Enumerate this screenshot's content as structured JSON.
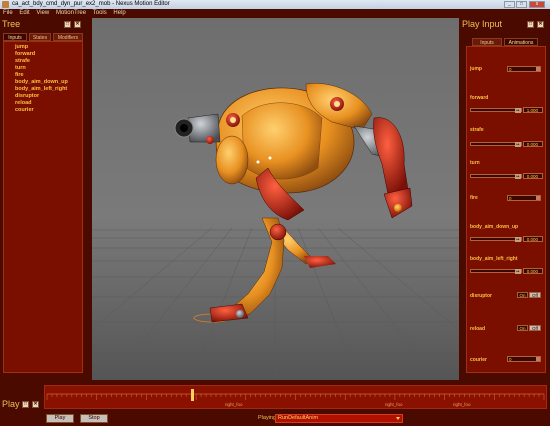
{
  "window": {
    "title": "ca_act_bdy_cmd_dyn_pur_ex2_mob - Nexus Motion Editor"
  },
  "menu": [
    "File",
    "Edit",
    "View",
    "MotionTree",
    "Tools",
    "Help"
  ],
  "tree": {
    "title": "Tree",
    "tabs": [
      "Inputs",
      "States",
      "Modifiers"
    ],
    "active_tab": "Inputs",
    "items": [
      "jump",
      "forward",
      "strafe",
      "turn",
      "fire",
      "body_aim_down_up",
      "body_aim_left_right",
      "disruptor",
      "reload",
      "courier"
    ]
  },
  "play_input": {
    "title": "Play Input",
    "tabs": [
      "Inputs",
      "Animations"
    ],
    "active_tab": "Animations",
    "jump": {
      "label": "jump",
      "value": "0"
    },
    "forward": {
      "label": "forward",
      "value": "1.000"
    },
    "strafe": {
      "label": "strafe",
      "value": "0.000"
    },
    "turn": {
      "label": "turn",
      "value": "0.000"
    },
    "fire": {
      "label": "fire",
      "value": "0"
    },
    "body_aim_down_up": {
      "label": "body_aim_down_up",
      "value": "0.000"
    },
    "body_aim_left_right": {
      "label": "body_aim_left_right",
      "value": "0.000"
    },
    "disruptor": {
      "label": "disruptor",
      "on": "On",
      "off": "Off"
    },
    "reload": {
      "label": "reload",
      "on": "On",
      "off": "Off"
    },
    "courier": {
      "label": "courier",
      "value": "0"
    }
  },
  "play": {
    "title": "Play",
    "play_button": "Play",
    "stop_button": "Stop",
    "playing_label": "Playing:",
    "playing_value": "RunDefaultAnim",
    "timeline_labels": [
      "right_foo",
      "right_foo",
      "right_foo"
    ]
  },
  "colors": {
    "bg": "#4a0a00",
    "panel": "#7a0f00",
    "accent": "#f2c050",
    "viewport": "#727272"
  }
}
